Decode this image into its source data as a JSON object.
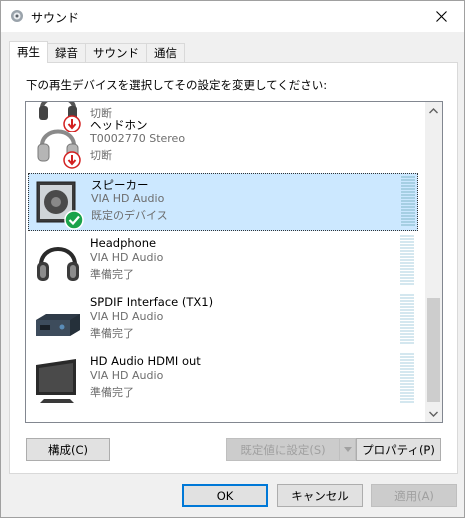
{
  "window": {
    "title": "サウンド",
    "icon": "speaker-icon"
  },
  "tabs": [
    {
      "label": "再生",
      "active": true
    },
    {
      "label": "録音",
      "active": false
    },
    {
      "label": "サウンド",
      "active": false
    },
    {
      "label": "通信",
      "active": false
    }
  ],
  "instruction": "下の再生デバイスを選択してその設定を変更してください:",
  "devices": [
    {
      "name": "",
      "sub": "",
      "status": "切断",
      "icon": "headset-disconnected-icon",
      "selected": false
    },
    {
      "name": "ヘッドホン",
      "sub": "T0002770 Stereo",
      "status": "切断",
      "icon": "headphones-disconnected-icon",
      "selected": false
    },
    {
      "name": "スピーカー",
      "sub": "VIA HD Audio",
      "status": "既定のデバイス",
      "icon": "speaker-default-icon",
      "selected": true
    },
    {
      "name": "Headphone",
      "sub": "VIA HD Audio",
      "status": "準備完了",
      "icon": "headphones-icon",
      "selected": false
    },
    {
      "name": "SPDIF Interface (TX1)",
      "sub": "VIA HD Audio",
      "status": "準備完了",
      "icon": "spdif-device-icon",
      "selected": false
    },
    {
      "name": "HD Audio HDMI out",
      "sub": "VIA HD Audio",
      "status": "準備完了",
      "icon": "monitor-icon",
      "selected": false
    }
  ],
  "buttons": {
    "configure": "構成(C)",
    "set_default": "既定値に設定(S)",
    "properties": "プロパティ(P)",
    "ok": "OK",
    "cancel": "キャンセル",
    "apply": "適用(A)"
  },
  "colors": {
    "selection": "#cce8ff",
    "accent": "#0078d7",
    "check_green": "#1aa34a",
    "disconnect_red": "#d32020"
  }
}
